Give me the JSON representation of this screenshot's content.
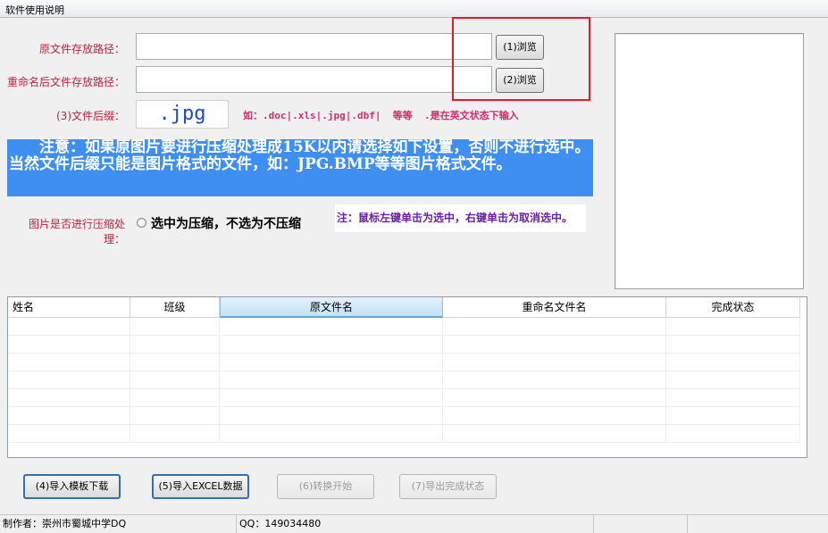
{
  "menu": {
    "title": "软件使用说明"
  },
  "form": {
    "source_label": "原文件存放路径：",
    "source_value": "",
    "target_label": "重命名后文件存放路径：",
    "target_value": "",
    "browse1_label": "(1)浏览",
    "browse2_label": "(2)浏览",
    "suffix_label": "(3)文件后缀：",
    "suffix_value": ".jpg",
    "suffix_hint": "如：.doc|.xls|.jpg|.dbf|  等等  .是在英文状态下输入"
  },
  "notice": {
    "text": "　　注意：如果原图片要进行压缩处理成15K以内请选择如下设置，否则不进行选中。当然文件后缀只能是图片格式的文件，如：JPG.BMP等等图片格式文件。"
  },
  "compress": {
    "label": "图片是否进行压缩处理：",
    "option_text": "选中为压缩，不选为不压缩",
    "tip": "注：鼠标左键单击为选中，右键单击为取消选中。"
  },
  "table": {
    "columns": [
      "姓名",
      "班级",
      "原文件名",
      "重命名文件名",
      "完成状态"
    ]
  },
  "buttons": {
    "template": "(4)导入模板下载",
    "import_excel": "(5)导入EXCEL数据",
    "convert": "(6)转换开始",
    "export_status": "(7)导出完成状态"
  },
  "status": {
    "author": "制作者：崇州市蜀城中学DQ",
    "qq": "QQ：149034480"
  }
}
